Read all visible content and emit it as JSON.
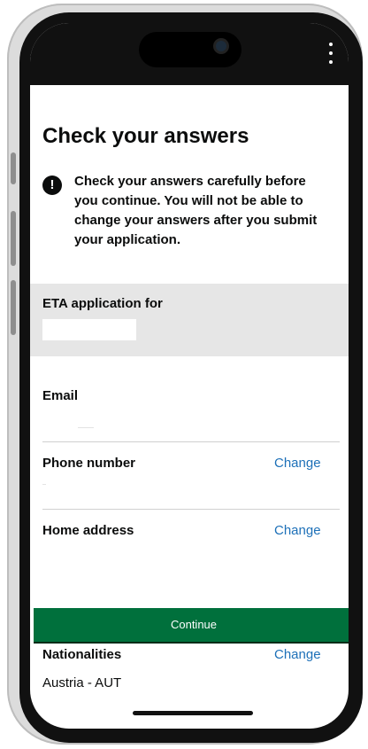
{
  "header": {
    "title": "Check your answers"
  },
  "warning": {
    "icon": "exclamation-icon",
    "text": "Check your answers carefully before you continue. You will not be able to change your answers after you submit your application."
  },
  "summary": {
    "eta_label": "ETA application for",
    "email_label": "Email",
    "phone_label": "Phone number",
    "home_address_label": "Home address",
    "nationalities_label": "Nationalities",
    "nationalities_value": "Austria - AUT",
    "change_label": "Change"
  },
  "actions": {
    "continue_label": "Continue"
  },
  "colors": {
    "link": "#1d70b8",
    "button": "#00703c",
    "text": "#0b0c0c",
    "panel": "#e6e6e6"
  }
}
